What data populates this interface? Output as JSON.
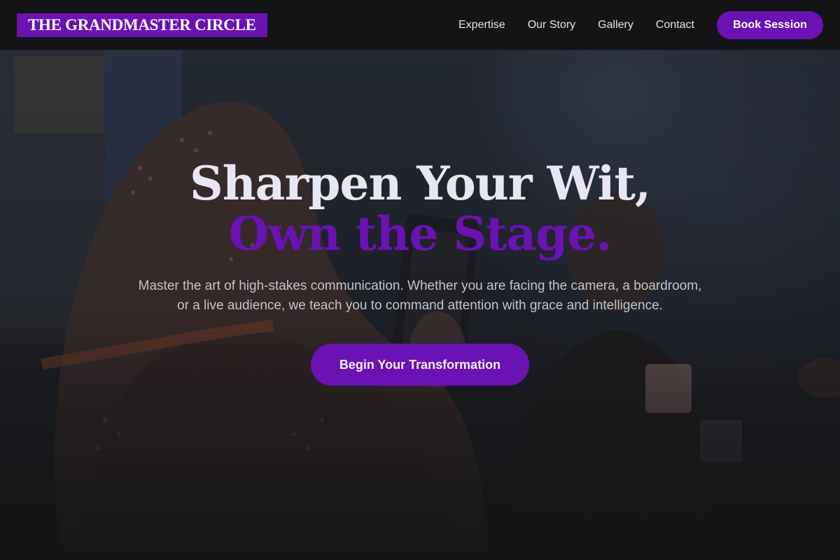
{
  "brand": {
    "logo_text": "THE GRANDMASTER CIRCLE",
    "accent_color": "#6a12b3"
  },
  "nav": {
    "links": [
      {
        "label": "Expertise"
      },
      {
        "label": "Our Story"
      },
      {
        "label": "Gallery"
      },
      {
        "label": "Contact"
      }
    ],
    "cta_label": "Book Session"
  },
  "hero": {
    "headline_line1": "Sharpen Your Wit,",
    "headline_line2": "Own the Stage.",
    "subheading": "Master the art of high-stakes communication. Whether you are facing the camera, a boardroom, or a live audience, we teach you to command attention with grace and intelligence.",
    "cta_label": "Begin Your Transformation",
    "background_image": "photo of a woman in a patterned headscarf filming another smiling woman on a phone"
  }
}
